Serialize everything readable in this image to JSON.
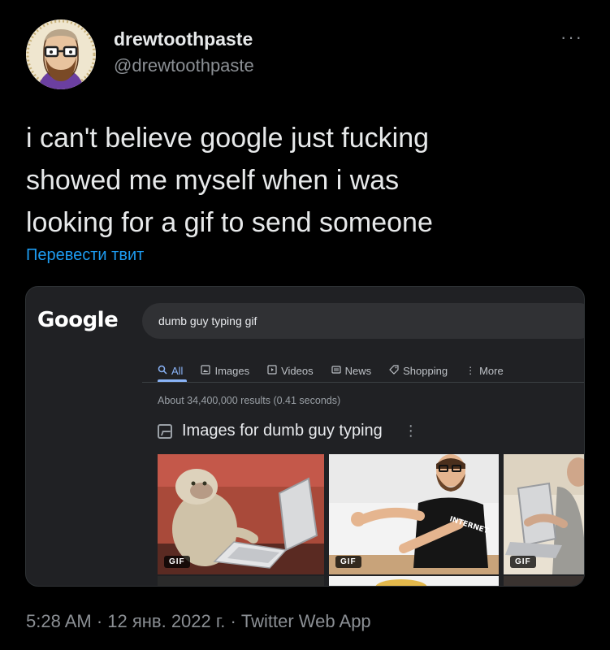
{
  "tweet": {
    "display_name": "drewtoothpaste",
    "handle": "@drewtoothpaste",
    "more_icon": "···",
    "text_lines": [
      "i can't believe google just fucking",
      "showed me myself when i was",
      "looking for a gif to send someone"
    ],
    "translate_label": "Перевести твит",
    "timestamp": "5:28 AM · 12 янв. 2022 г. · Twitter Web App"
  },
  "screenshot": {
    "logo": "Google",
    "search_query": "dumb guy typing gif",
    "tabs": [
      {
        "label": "All",
        "icon": "search-icon",
        "active": true
      },
      {
        "label": "Images",
        "icon": "image-icon",
        "active": false
      },
      {
        "label": "Videos",
        "icon": "play-icon",
        "active": false
      },
      {
        "label": "News",
        "icon": "news-icon",
        "active": false
      },
      {
        "label": "Shopping",
        "icon": "tag-icon",
        "active": false
      },
      {
        "label": "More",
        "icon": "kebab-icon",
        "active": false
      }
    ],
    "result_stats": "About 34,400,000 results (0.41 seconds)",
    "section_title": "Images for dumb guy typing",
    "gif_badge": "GIF",
    "shirt_text": "INTERNET"
  },
  "colors": {
    "background": "#000000",
    "link": "#1d9bf0",
    "google_accent": "#8ab4f8",
    "panel": "#202124"
  }
}
